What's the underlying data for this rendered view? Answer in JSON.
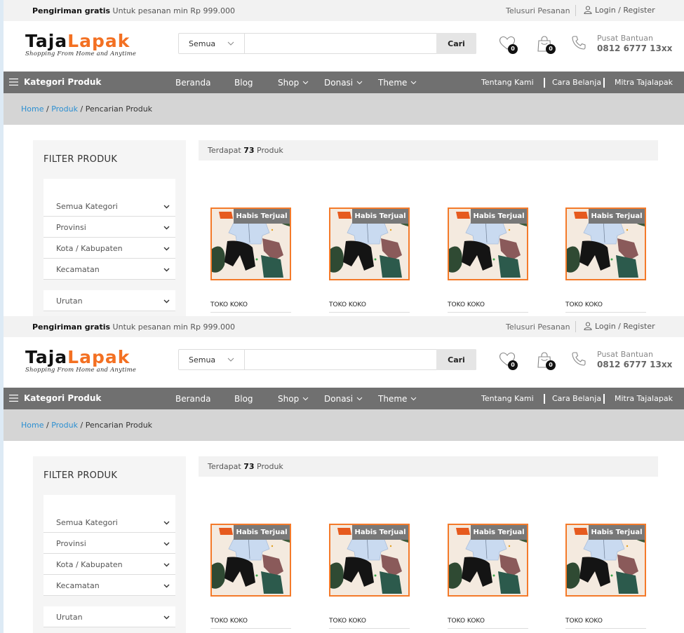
{
  "topbar": {
    "shipping_bold": "Pengiriman gratis",
    "shipping_rest": "Untuk pesanan min Rp 999.000",
    "track": "Telusuri Pesanan",
    "login": "Login / Register"
  },
  "header": {
    "logo_part1": "Taja",
    "logo_part2": "Lapak",
    "tagline": "Shopping From Home and Anytime",
    "search_category": "Semua",
    "search_placeholder": "",
    "search_button": "Cari",
    "wishlist_count": "0",
    "cart_count": "0",
    "help_label": "Pusat Bantuan",
    "help_phone": "0812 6777 13xx"
  },
  "nav": {
    "category": "Kategori Produk",
    "menu": [
      {
        "label": "Beranda"
      },
      {
        "label": "Blog"
      },
      {
        "label": "Shop"
      },
      {
        "label": "Donasi"
      },
      {
        "label": "Theme"
      }
    ],
    "right": [
      {
        "label": "Tentang Kami"
      },
      {
        "label": "Cara Belanja"
      },
      {
        "label": "Mitra Tajalapak"
      }
    ]
  },
  "breadcrumb": {
    "home": "Home",
    "produk": "Produk",
    "current": "Pencarian Produk",
    "separator": "/"
  },
  "filter": {
    "title": "FILTER PRODUK",
    "selects": [
      "Semua Kategori",
      "Provinsi",
      "Kota / Kabupaten",
      "Kecamatan"
    ],
    "sort": "Urutan"
  },
  "results": {
    "prefix": "Terdapat",
    "count": "73",
    "suffix": "Produk"
  },
  "products": [
    {
      "badge": "Habis Terjual",
      "store": "TOKO KOKO"
    },
    {
      "badge": "Habis Terjual",
      "store": "TOKO KOKO"
    },
    {
      "badge": "Habis Terjual",
      "store": "TOKO KOKO"
    },
    {
      "badge": "Habis Terjual",
      "store": "TOKO KOKO"
    }
  ],
  "colors": {
    "accent": "#f37022",
    "nav_bg": "#707070",
    "link": "#2c8fd1",
    "breadcrumb_bg": "#d5d5d5"
  }
}
